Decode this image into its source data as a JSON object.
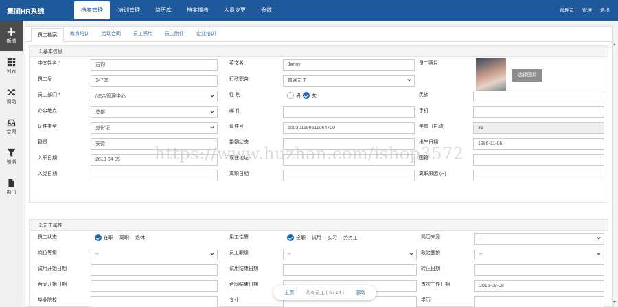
{
  "app": {
    "title": "集团HR系统"
  },
  "nav": [
    "档案管理",
    "培训管理",
    "简历库",
    "档案报表",
    "人员变更",
    "参数"
  ],
  "top_right": [
    "管理员",
    "管理",
    "退出"
  ],
  "rail": [
    {
      "label": "新增",
      "icon": "plus-icon"
    },
    {
      "label": "列表",
      "icon": "grid-icon"
    },
    {
      "label": "调动",
      "icon": "shuffle-icon"
    },
    {
      "label": "合同",
      "icon": "inbox-icon"
    },
    {
      "label": "培训",
      "icon": "funnel-icon"
    },
    {
      "label": "部门",
      "icon": "document-icon"
    }
  ],
  "tabs": [
    "员工档案",
    "教育培训",
    "劳动合同",
    "员工照片",
    "员工附件",
    "企业培训"
  ],
  "section1": {
    "title": "1.基本信息",
    "chinese_name": {
      "label": "中文姓名",
      "value": "吉钧"
    },
    "english_name": {
      "label": "英文名",
      "value": "Jenny"
    },
    "photo": {
      "label": "员工照片",
      "button": "选择图片"
    },
    "employee_no": {
      "label": "员工号",
      "value": "14785"
    },
    "position": {
      "label": "行政职务",
      "value": "普通员工"
    },
    "department": {
      "label": "员工部门",
      "value": "/综合管理中心"
    },
    "gender": {
      "label": "性 别",
      "opt1": "男",
      "opt2": "女"
    },
    "ethnicity": {
      "label": "民族",
      "value": ""
    },
    "office": {
      "label": "办公地点",
      "value": "总部"
    },
    "email": {
      "label": "邮 件",
      "value": ""
    },
    "mobile": {
      "label": "手机",
      "value": ""
    },
    "id_type": {
      "label": "证件类型",
      "value": "身份证"
    },
    "id_no": {
      "label": "证件号",
      "value": "150301198611064700"
    },
    "age": {
      "label": "年龄（自动)",
      "value": "36"
    },
    "native": {
      "label": "籍贯",
      "value": "安徽"
    },
    "marital": {
      "label": "婚姻状态",
      "value": ""
    },
    "birthday": {
      "label": "出生日期",
      "value": "1986-11-06"
    },
    "hire_date": {
      "label": "入职日期",
      "value": "2013-04-05"
    },
    "address": {
      "label": "现住地址",
      "value": ""
    },
    "nationality": {
      "label": "国籍",
      "value": ""
    },
    "party_date": {
      "label": "入党日期",
      "value": ""
    },
    "leave_date": {
      "label": "离职日期",
      "value": ""
    },
    "leave_reason": {
      "label": "离职原因 (R)",
      "value": ""
    }
  },
  "section2": {
    "title": "2.员工属性",
    "status": {
      "label": "员工状态",
      "opts": [
        "在职",
        "离职",
        "退休"
      ]
    },
    "emp_type": {
      "label": "用工性质",
      "opts": [
        "全职",
        "试用",
        "实习",
        "劳务工"
      ]
    },
    "resume_source": {
      "label": "简历来源",
      "value": "--"
    },
    "post_level": {
      "label": "岗位等级",
      "value": "--"
    },
    "emp_level": {
      "label": "员工职级",
      "value": "--"
    },
    "political": {
      "label": "政治面貌",
      "value": "--"
    },
    "trial_start": {
      "label": "试用开始日期",
      "value": ""
    },
    "trial_end": {
      "label": "试用结束日期",
      "value": ""
    },
    "regular_date": {
      "label": "转正日期",
      "value": ""
    },
    "contract_start": {
      "label": "合同开始日期",
      "value": ""
    },
    "contract_end": {
      "label": "合同结束日期",
      "value": ""
    },
    "first_work": {
      "label": "首次工作日期",
      "value": "2016-08-08"
    },
    "school": {
      "label": "毕业院校",
      "value": ""
    },
    "major": {
      "label": "专业",
      "value": ""
    },
    "degree": {
      "label": "学历",
      "value": ""
    }
  },
  "watermark": "https://www.huzhan.com/ishop3572",
  "pager": {
    "home": "主页",
    "count": "共有员工 ( 5 / 14 )",
    "scroll": "滚动"
  }
}
